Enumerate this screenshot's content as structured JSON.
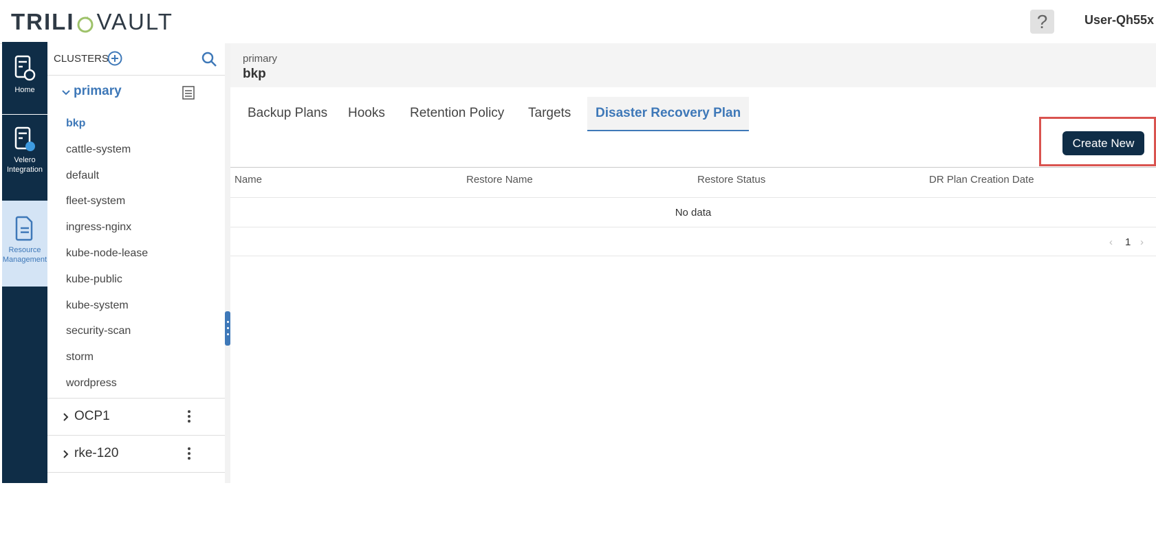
{
  "header": {
    "logo_text_a": "TRILI",
    "logo_text_b": "VAULT",
    "help_label": "?",
    "user_name": "User-Qh55x"
  },
  "rail": {
    "items": [
      {
        "label": "Home",
        "icon": "home-icon"
      },
      {
        "label_line1": "Velero",
        "label_line2": "Integration",
        "icon": "velero-icon"
      },
      {
        "label_line1": "Resource",
        "label_line2": "Management",
        "icon": "document-icon",
        "active": true
      }
    ]
  },
  "clusters": {
    "title": "CLUSTERS",
    "primary": {
      "name": "primary",
      "namespaces": [
        "bkp",
        "cattle-system",
        "default",
        "fleet-system",
        "ingress-nginx",
        "kube-node-lease",
        "kube-public",
        "kube-system",
        "security-scan",
        "storm",
        "wordpress"
      ],
      "selected": "bkp"
    },
    "others": [
      "OCP1",
      "rke-120"
    ]
  },
  "breadcrumb": {
    "parent": "primary",
    "current": "bkp"
  },
  "tabs": [
    "Backup Plans",
    "Hooks",
    "Retention Policy",
    "Targets",
    "Disaster Recovery Plan"
  ],
  "active_tab": "Disaster Recovery Plan",
  "actions": {
    "create_new": "Create New"
  },
  "table": {
    "columns": [
      "Name",
      "Restore Name",
      "Restore Status",
      "DR Plan Creation Date"
    ],
    "empty_text": "No data"
  },
  "pagination": {
    "page": "1",
    "prev": "‹",
    "next": "›"
  },
  "colors": {
    "nav_dark": "#0f2d47",
    "accent_blue": "#3e78b8",
    "highlight_red": "#d9534f"
  }
}
